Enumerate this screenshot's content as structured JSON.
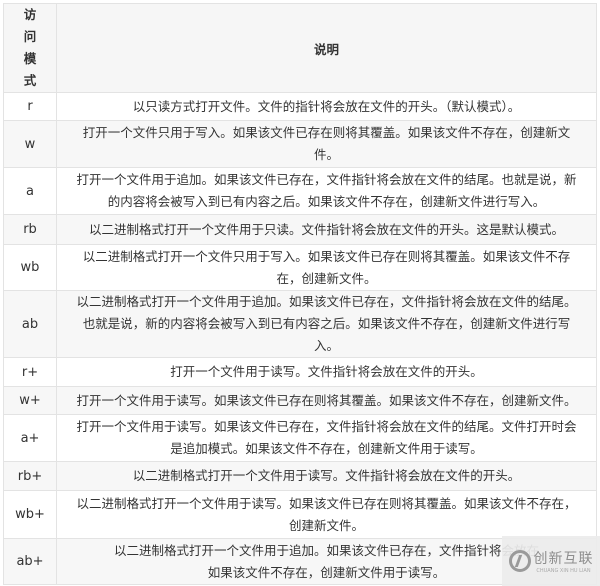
{
  "header": {
    "mode": "访问模式",
    "mode_chars": [
      "访",
      "问",
      "模",
      "式"
    ],
    "description": "说明"
  },
  "rows": [
    {
      "mode": "r",
      "lines": [
        "以只读方式打开文件。文件的指针将会放在文件的开头。（默认模式）。"
      ]
    },
    {
      "mode": "w",
      "lines": [
        "打开一个文件只用于写入。如果该文件已存在则将其覆盖。如果该文件不存在，创建新文",
        "件。"
      ]
    },
    {
      "mode": "a",
      "lines": [
        "打开一个文件用于追加。如果该文件已存在，文件指针将会放在文件的结尾。也就是说，新",
        "的内容将会被写入到已有内容之后。如果该文件不存在，创建新文件进行写入。"
      ]
    },
    {
      "mode": "rb",
      "lines": [
        "以二进制格式打开一个文件用于只读。文件指针将会放在文件的开头。这是默认模式。"
      ]
    },
    {
      "mode": "wb",
      "lines": [
        "以二进制格式打开一个文件只用于写入。如果该文件已存在则将其覆盖。如果该文件不存",
        "在，创建新文件。"
      ]
    },
    {
      "mode": "ab",
      "lines": [
        "以二进制格式打开一个文件用于追加。如果该文件已存在，文件指针将会放在文件的结尾。",
        "也就是说，新的内容将会被写入到已有内容之后。如果该文件不存在，创建新文件进行写",
        "入。"
      ]
    },
    {
      "mode": "r+",
      "lines": [
        "打开一个文件用于读写。文件指针将会放在文件的开头。"
      ]
    },
    {
      "mode": "w+",
      "lines": [
        "打开一个文件用于读写。如果该文件已存在则将其覆盖。如果该文件不存在，创建新文件。"
      ]
    },
    {
      "mode": "a+",
      "lines": [
        "打开一个文件用于读写。如果该文件已存在，文件指针将会放在文件的结尾。文件打开时会",
        "是追加模式。如果该文件不存在，创建新文件用于读写。"
      ]
    },
    {
      "mode": "rb+",
      "lines": [
        "以二进制格式打开一个文件用于读写。文件指针将会放在文件的开头。"
      ]
    },
    {
      "mode": "wb+",
      "lines": [
        "以二进制格式打开一个文件用于读写。如果该文件已存在则将其覆盖。如果该文件不存在，",
        "创建新文件。"
      ]
    },
    {
      "mode": "ab+",
      "lines": [
        "以二进制格式打开一个文件用于追加。如果该文件已存在，文件指针将会放在",
        "如果该文件不存在，创建新文件用于读写。"
      ]
    }
  ],
  "watermark": {
    "cn": "创新互联",
    "en": "CHUANG XIN HU LIAN"
  }
}
